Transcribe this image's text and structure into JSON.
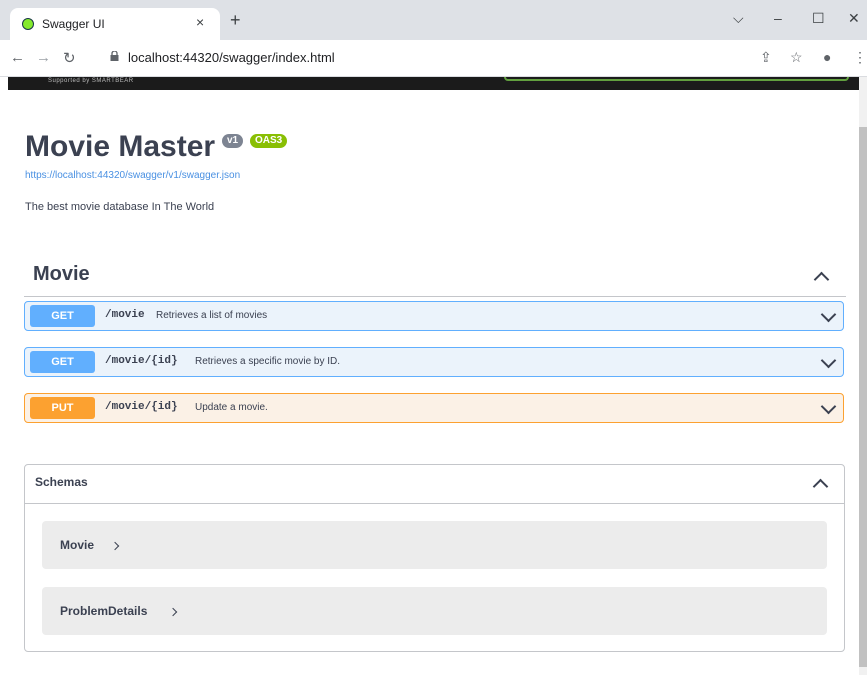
{
  "browser": {
    "tab_title": "Swagger UI",
    "tab_close": "×",
    "new_tab": "+",
    "url": "localhost:44320/swagger/index.html",
    "controls": {
      "dropdown": "⌵",
      "minimize": "–",
      "maximize": "☐",
      "close": "✕"
    },
    "nav": {
      "back": "←",
      "forward": "→",
      "reload": "↻"
    },
    "toolbar_icons": {
      "share": "⇪",
      "star": "☆",
      "profile": "●",
      "menu": "⋮"
    }
  },
  "topbar": {
    "brand_text": "Supported by SMARTBEAR"
  },
  "info": {
    "title": "Movie Master",
    "version_badge": "v1",
    "oas_badge": "OAS3",
    "spec_url": "https://localhost:44320/swagger/v1/swagger.json",
    "description": "The best movie database In The World"
  },
  "tag": {
    "name": "Movie"
  },
  "operations": [
    {
      "method": "GET",
      "path": "/movie",
      "summary": "Retrieves a list of movies"
    },
    {
      "method": "GET",
      "path": "/movie/{id}",
      "summary": "Retrieves a specific movie by ID."
    },
    {
      "method": "PUT",
      "path": "/movie/{id}",
      "summary": "Update a movie."
    }
  ],
  "schemas": {
    "title": "Schemas",
    "models": [
      "Movie",
      "ProblemDetails"
    ]
  },
  "colors": {
    "get": "#61affe",
    "put": "#fca130",
    "oas": "#89bf04",
    "version": "#7d8492",
    "text": "#3b4151"
  }
}
